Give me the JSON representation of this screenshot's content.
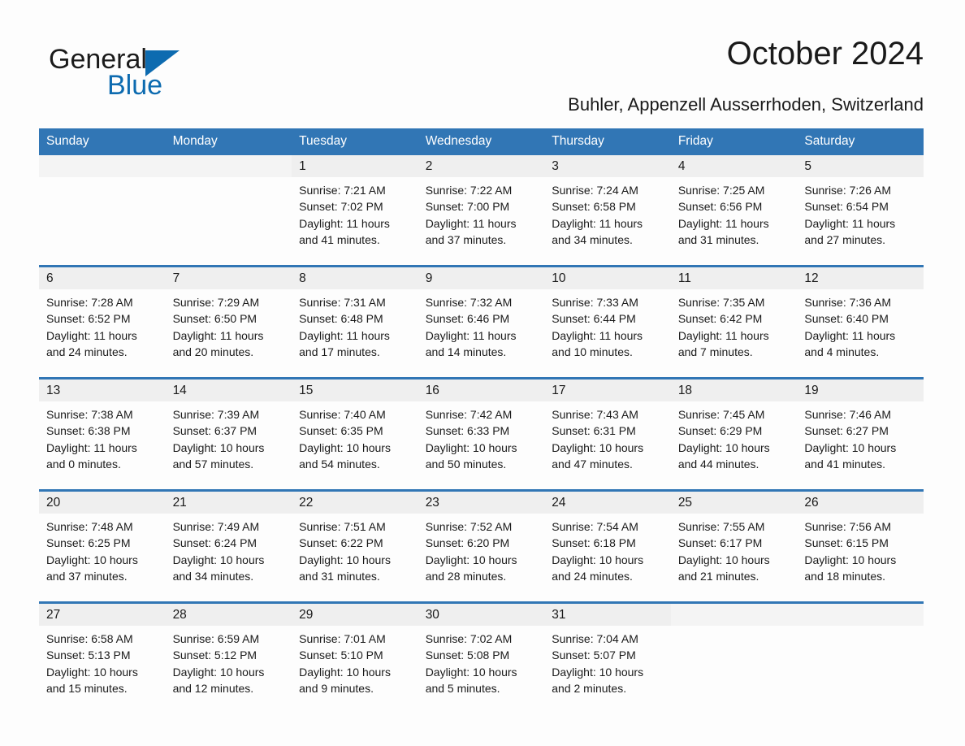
{
  "brand": {
    "name_part1": "General",
    "name_part2": "Blue",
    "accent_color": "#0d6bb0"
  },
  "header": {
    "title": "October 2024",
    "subtitle": "Buhler, Appenzell Ausserrhoden, Switzerland"
  },
  "theme": {
    "header_blue": "#3176b5",
    "day_band_gray": "#efefef",
    "page_background": "#fdfdfd"
  },
  "calendar": {
    "weekday_headers": [
      "Sunday",
      "Monday",
      "Tuesday",
      "Wednesday",
      "Thursday",
      "Friday",
      "Saturday"
    ],
    "weeks": [
      [
        {
          "day": "",
          "lines": []
        },
        {
          "day": "",
          "lines": []
        },
        {
          "day": "1",
          "lines": [
            "Sunrise: 7:21 AM",
            "Sunset: 7:02 PM",
            "Daylight: 11 hours",
            "and 41 minutes."
          ]
        },
        {
          "day": "2",
          "lines": [
            "Sunrise: 7:22 AM",
            "Sunset: 7:00 PM",
            "Daylight: 11 hours",
            "and 37 minutes."
          ]
        },
        {
          "day": "3",
          "lines": [
            "Sunrise: 7:24 AM",
            "Sunset: 6:58 PM",
            "Daylight: 11 hours",
            "and 34 minutes."
          ]
        },
        {
          "day": "4",
          "lines": [
            "Sunrise: 7:25 AM",
            "Sunset: 6:56 PM",
            "Daylight: 11 hours",
            "and 31 minutes."
          ]
        },
        {
          "day": "5",
          "lines": [
            "Sunrise: 7:26 AM",
            "Sunset: 6:54 PM",
            "Daylight: 11 hours",
            "and 27 minutes."
          ]
        }
      ],
      [
        {
          "day": "6",
          "lines": [
            "Sunrise: 7:28 AM",
            "Sunset: 6:52 PM",
            "Daylight: 11 hours",
            "and 24 minutes."
          ]
        },
        {
          "day": "7",
          "lines": [
            "Sunrise: 7:29 AM",
            "Sunset: 6:50 PM",
            "Daylight: 11 hours",
            "and 20 minutes."
          ]
        },
        {
          "day": "8",
          "lines": [
            "Sunrise: 7:31 AM",
            "Sunset: 6:48 PM",
            "Daylight: 11 hours",
            "and 17 minutes."
          ]
        },
        {
          "day": "9",
          "lines": [
            "Sunrise: 7:32 AM",
            "Sunset: 6:46 PM",
            "Daylight: 11 hours",
            "and 14 minutes."
          ]
        },
        {
          "day": "10",
          "lines": [
            "Sunrise: 7:33 AM",
            "Sunset: 6:44 PM",
            "Daylight: 11 hours",
            "and 10 minutes."
          ]
        },
        {
          "day": "11",
          "lines": [
            "Sunrise: 7:35 AM",
            "Sunset: 6:42 PM",
            "Daylight: 11 hours",
            "and 7 minutes."
          ]
        },
        {
          "day": "12",
          "lines": [
            "Sunrise: 7:36 AM",
            "Sunset: 6:40 PM",
            "Daylight: 11 hours",
            "and 4 minutes."
          ]
        }
      ],
      [
        {
          "day": "13",
          "lines": [
            "Sunrise: 7:38 AM",
            "Sunset: 6:38 PM",
            "Daylight: 11 hours",
            "and 0 minutes."
          ]
        },
        {
          "day": "14",
          "lines": [
            "Sunrise: 7:39 AM",
            "Sunset: 6:37 PM",
            "Daylight: 10 hours",
            "and 57 minutes."
          ]
        },
        {
          "day": "15",
          "lines": [
            "Sunrise: 7:40 AM",
            "Sunset: 6:35 PM",
            "Daylight: 10 hours",
            "and 54 minutes."
          ]
        },
        {
          "day": "16",
          "lines": [
            "Sunrise: 7:42 AM",
            "Sunset: 6:33 PM",
            "Daylight: 10 hours",
            "and 50 minutes."
          ]
        },
        {
          "day": "17",
          "lines": [
            "Sunrise: 7:43 AM",
            "Sunset: 6:31 PM",
            "Daylight: 10 hours",
            "and 47 minutes."
          ]
        },
        {
          "day": "18",
          "lines": [
            "Sunrise: 7:45 AM",
            "Sunset: 6:29 PM",
            "Daylight: 10 hours",
            "and 44 minutes."
          ]
        },
        {
          "day": "19",
          "lines": [
            "Sunrise: 7:46 AM",
            "Sunset: 6:27 PM",
            "Daylight: 10 hours",
            "and 41 minutes."
          ]
        }
      ],
      [
        {
          "day": "20",
          "lines": [
            "Sunrise: 7:48 AM",
            "Sunset: 6:25 PM",
            "Daylight: 10 hours",
            "and 37 minutes."
          ]
        },
        {
          "day": "21",
          "lines": [
            "Sunrise: 7:49 AM",
            "Sunset: 6:24 PM",
            "Daylight: 10 hours",
            "and 34 minutes."
          ]
        },
        {
          "day": "22",
          "lines": [
            "Sunrise: 7:51 AM",
            "Sunset: 6:22 PM",
            "Daylight: 10 hours",
            "and 31 minutes."
          ]
        },
        {
          "day": "23",
          "lines": [
            "Sunrise: 7:52 AM",
            "Sunset: 6:20 PM",
            "Daylight: 10 hours",
            "and 28 minutes."
          ]
        },
        {
          "day": "24",
          "lines": [
            "Sunrise: 7:54 AM",
            "Sunset: 6:18 PM",
            "Daylight: 10 hours",
            "and 24 minutes."
          ]
        },
        {
          "day": "25",
          "lines": [
            "Sunrise: 7:55 AM",
            "Sunset: 6:17 PM",
            "Daylight: 10 hours",
            "and 21 minutes."
          ]
        },
        {
          "day": "26",
          "lines": [
            "Sunrise: 7:56 AM",
            "Sunset: 6:15 PM",
            "Daylight: 10 hours",
            "and 18 minutes."
          ]
        }
      ],
      [
        {
          "day": "27",
          "lines": [
            "Sunrise: 6:58 AM",
            "Sunset: 5:13 PM",
            "Daylight: 10 hours",
            "and 15 minutes."
          ]
        },
        {
          "day": "28",
          "lines": [
            "Sunrise: 6:59 AM",
            "Sunset: 5:12 PM",
            "Daylight: 10 hours",
            "and 12 minutes."
          ]
        },
        {
          "day": "29",
          "lines": [
            "Sunrise: 7:01 AM",
            "Sunset: 5:10 PM",
            "Daylight: 10 hours",
            "and 9 minutes."
          ]
        },
        {
          "day": "30",
          "lines": [
            "Sunrise: 7:02 AM",
            "Sunset: 5:08 PM",
            "Daylight: 10 hours",
            "and 5 minutes."
          ]
        },
        {
          "day": "31",
          "lines": [
            "Sunrise: 7:04 AM",
            "Sunset: 5:07 PM",
            "Daylight: 10 hours",
            "and 2 minutes."
          ]
        },
        {
          "day": "",
          "lines": []
        },
        {
          "day": "",
          "lines": []
        }
      ]
    ]
  }
}
